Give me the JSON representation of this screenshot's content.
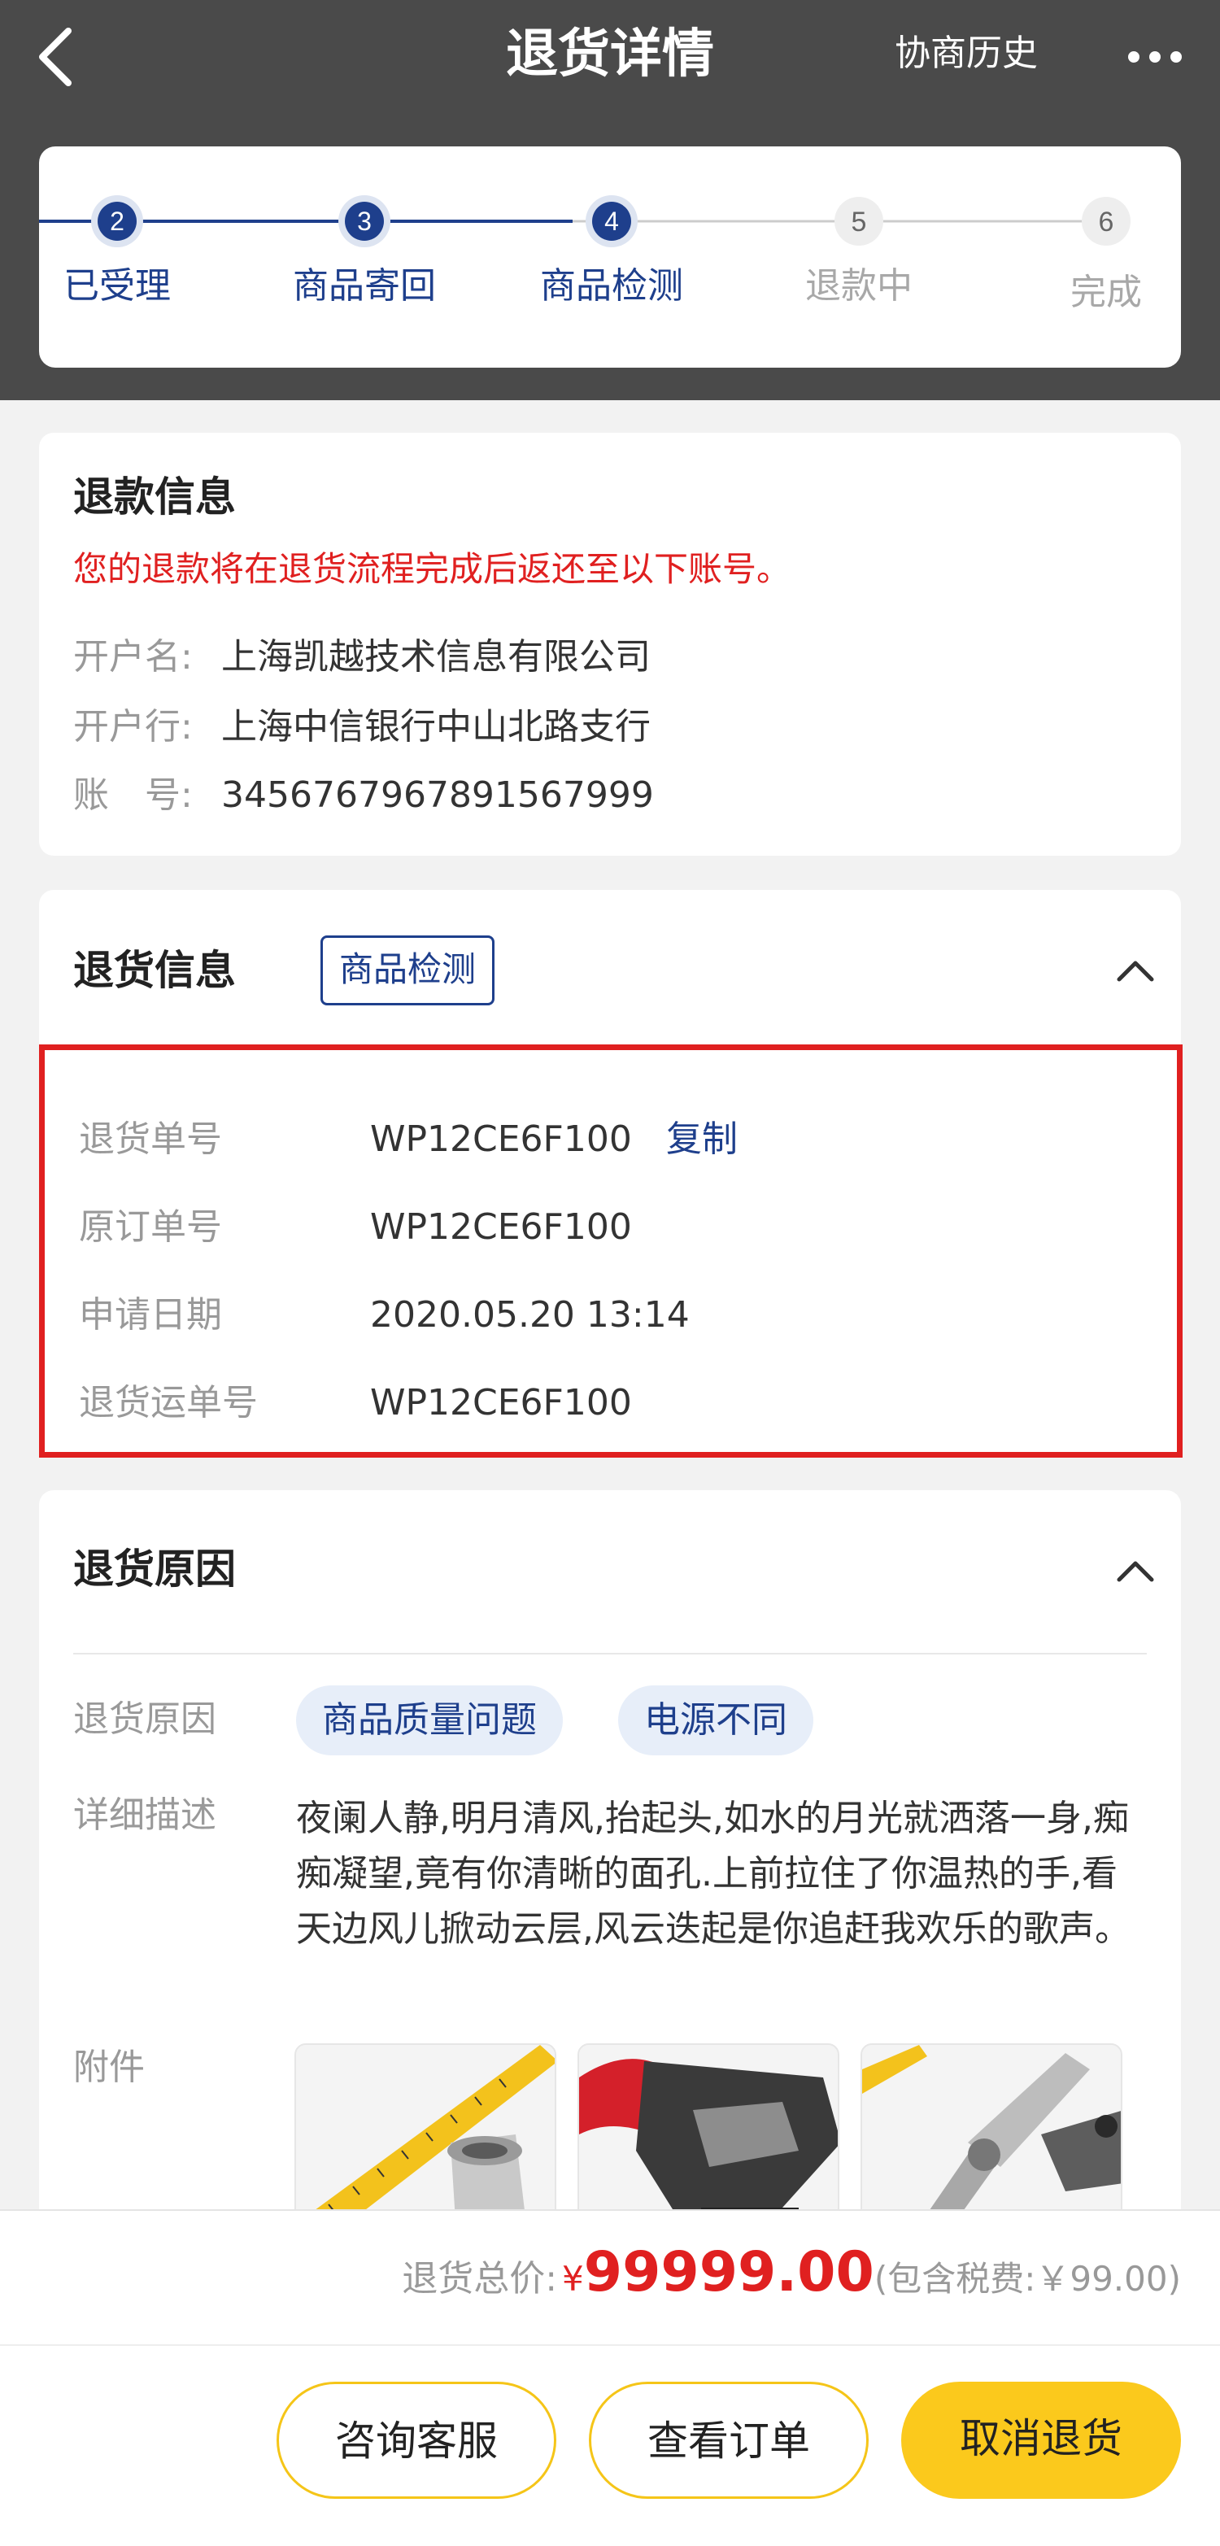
{
  "nav": {
    "title": "退货详情",
    "history_link": "协商历史"
  },
  "steps": [
    {
      "num": "2",
      "label": "已受理",
      "active": true
    },
    {
      "num": "3",
      "label": "商品寄回",
      "active": true
    },
    {
      "num": "4",
      "label": "商品检测",
      "active": true
    },
    {
      "num": "5",
      "label": "退款中",
      "active": false
    },
    {
      "num": "6",
      "label": "完成",
      "active": false
    }
  ],
  "refund": {
    "title": "退款信息",
    "note": "您的退款将在退货流程完成后返还至以下账号。",
    "rows": [
      {
        "label": "开户名:",
        "value": "上海凯越技术信息有限公司"
      },
      {
        "label": "开户行:",
        "value": "上海中信银行中山北路支行"
      },
      {
        "label": "账　号:",
        "value": "3456767967891567999"
      }
    ]
  },
  "return_info": {
    "title": "退货信息",
    "status": "商品检测",
    "copy_label": "复制",
    "rows": [
      {
        "label": "退货单号",
        "value": "WP12CE6F100"
      },
      {
        "label": "原订单号",
        "value": "WP12CE6F100"
      },
      {
        "label": "申请日期",
        "value": "2020.05.20 13:14"
      },
      {
        "label": "退货运单号",
        "value": "WP12CE6F100"
      }
    ]
  },
  "reason": {
    "title": "退货原因",
    "reason_label": "退货原因",
    "chips": [
      "商品质量问题",
      "电源不同"
    ],
    "desc_label": "详细描述",
    "description": "夜阑人静,明月清风,抬起头,如水的月光就洒落一身,痴痴凝望,竟有你清晰的面孔.上前拉住了你温热的手,看天边风儿掀动云层,风云迭起是你追赶我欢乐的歌声。",
    "attach_label": "附件"
  },
  "footer": {
    "total_label": "退货总价:",
    "currency": "¥",
    "amount": "99999.00",
    "tax_text": "(包含税费:￥99.00)",
    "buttons": {
      "consult": "咨询客服",
      "view_order": "查看订单",
      "cancel": "取消退货"
    }
  },
  "colors": {
    "header_bg": "#4a4a4a",
    "accent_blue": "#1e3f8c",
    "alert_red": "#e02020",
    "button_yellow": "#fbc91c",
    "chip_bg": "#e7eef9"
  },
  "icons": [
    "back-arrow-icon",
    "more-dots-icon",
    "chevron-up-icon"
  ]
}
